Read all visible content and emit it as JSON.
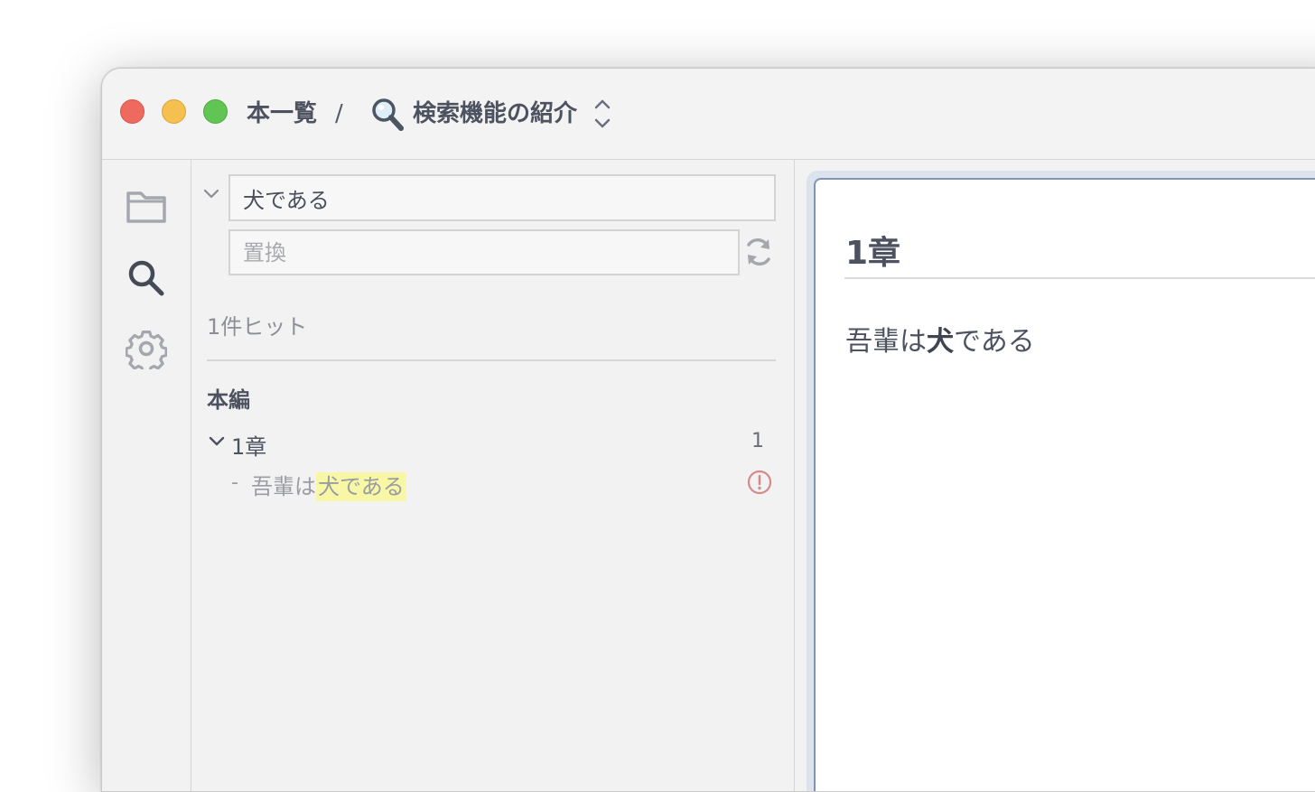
{
  "titlebar": {
    "breadcrumb_root": "本一覧",
    "separator": "/",
    "current_icon": "magnifier-icon",
    "current_title": "検索機能の紹介"
  },
  "activitybar": {
    "items": [
      {
        "icon": "folder-icon"
      },
      {
        "icon": "search-icon"
      },
      {
        "icon": "gear-icon"
      }
    ]
  },
  "search": {
    "query_value": "犬である",
    "replace_placeholder": "置換",
    "hit_count": "1件ヒット",
    "group_title": "本編",
    "results": [
      {
        "label": "1章",
        "count": "1",
        "matches": [
          {
            "prefix": "吾輩は",
            "highlight": "犬である"
          }
        ]
      }
    ]
  },
  "editor": {
    "heading": "1章",
    "paragraph_before": "吾輩は",
    "paragraph_bold": "犬",
    "paragraph_after": "である"
  },
  "colors": {
    "close": "#ee6a5f",
    "minimize": "#f5c04f",
    "maximize": "#61c554",
    "highlight": "#f7f7a6",
    "warning": "#d48a8a",
    "editor_border": "#7e93b9"
  }
}
